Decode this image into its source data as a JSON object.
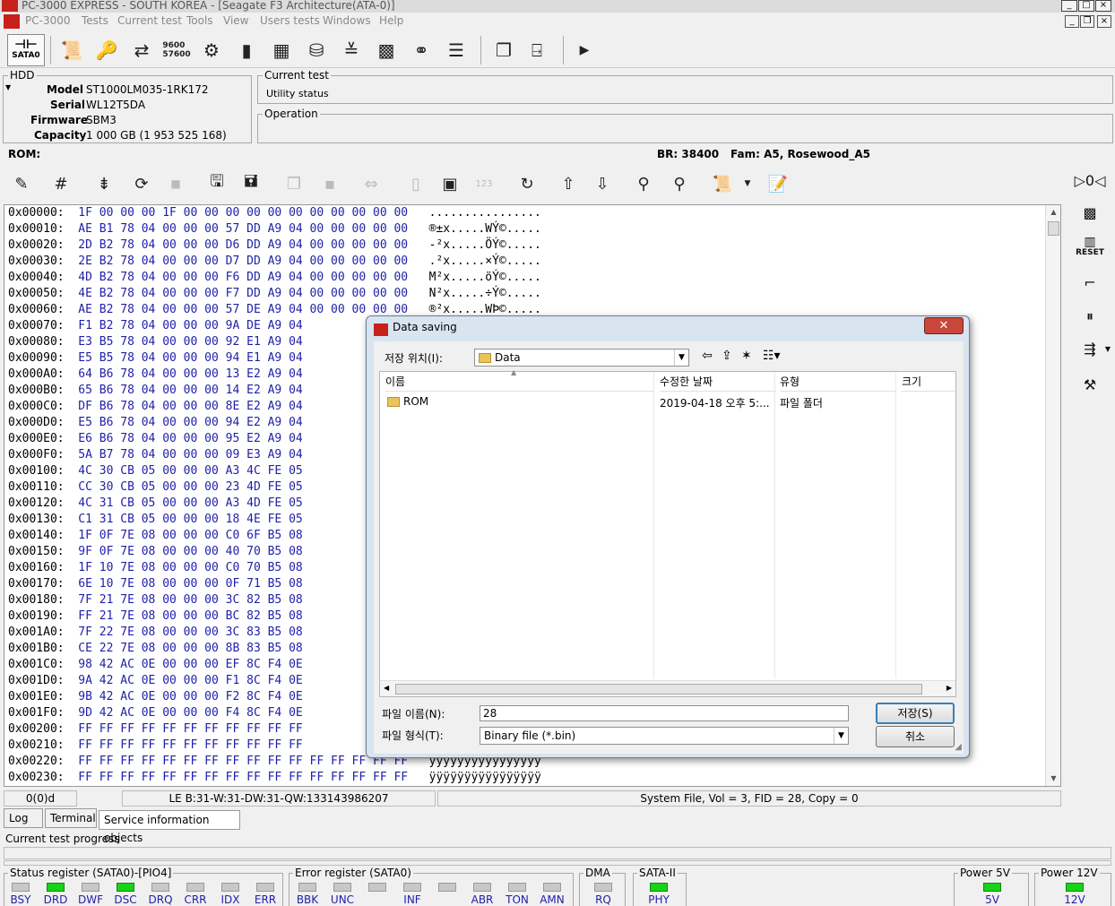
{
  "window": {
    "title": "PC-3000 EXPRESS - SOUTH KOREA - [Seagate F3 Architecture(ATA-0)]"
  },
  "menu": {
    "items": [
      "PC-3000",
      "Tests",
      "Current test",
      "Tools",
      "View",
      "Users tests",
      "Windows",
      "Help"
    ]
  },
  "toolbar": {
    "sata_label": "SATA0"
  },
  "hdd": {
    "group_label": "HDD",
    "model_key": "Model",
    "model": "ST1000LM035-1RK172",
    "serial_key": "Serial",
    "serial": "WL12T5DA",
    "firmware_key": "Firmware",
    "firmware": "SBM3",
    "capacity_key": "Capacity",
    "capacity": "1 000 GB (1 953 525 168)"
  },
  "current_test": {
    "label": "Current test",
    "value": "Utility status"
  },
  "operation": {
    "label": "Operation"
  },
  "rom_bar": {
    "rom": "ROM:",
    "br": "BR: 38400",
    "fam": "Fam: A5, Rosewood_A5"
  },
  "hex_rows": [
    {
      "addr": "0x00000:",
      "bytes": "1F 00 00 00 1F 00 00 00 00 00 00 00 00 00 00 00",
      "ascii": "................"
    },
    {
      "addr": "0x00010:",
      "bytes": "AE B1 78 04 00 00 00 57 DD A9 04 00 00 00 00 00",
      "ascii": "®±x.....WÝ©....."
    },
    {
      "addr": "0x00020:",
      "bytes": "2D B2 78 04 00 00 00 D6 DD A9 04 00 00 00 00 00",
      "ascii": "-²x.....ÖÝ©....."
    },
    {
      "addr": "0x00030:",
      "bytes": "2E B2 78 04 00 00 00 D7 DD A9 04 00 00 00 00 00",
      "ascii": ".²x.....×Ý©....."
    },
    {
      "addr": "0x00040:",
      "bytes": "4D B2 78 04 00 00 00 F6 DD A9 04 00 00 00 00 00",
      "ascii": "M²x.....öÝ©....."
    },
    {
      "addr": "0x00050:",
      "bytes": "4E B2 78 04 00 00 00 F7 DD A9 04 00 00 00 00 00",
      "ascii": "N²x.....÷Ý©....."
    },
    {
      "addr": "0x00060:",
      "bytes": "AE B2 78 04 00 00 00 57 DE A9 04 00 00 00 00 00",
      "ascii": "®²x.....WÞ©....."
    },
    {
      "addr": "0x00070:",
      "bytes": "F1 B2 78 04 00 00 00 9A DE A9 04",
      "ascii": ""
    },
    {
      "addr": "0x00080:",
      "bytes": "E3 B5 78 04 00 00 00 92 E1 A9 04",
      "ascii": ""
    },
    {
      "addr": "0x00090:",
      "bytes": "E5 B5 78 04 00 00 00 94 E1 A9 04",
      "ascii": ""
    },
    {
      "addr": "0x000A0:",
      "bytes": "64 B6 78 04 00 00 00 13 E2 A9 04",
      "ascii": ""
    },
    {
      "addr": "0x000B0:",
      "bytes": "65 B6 78 04 00 00 00 14 E2 A9 04",
      "ascii": ""
    },
    {
      "addr": "0x000C0:",
      "bytes": "DF B6 78 04 00 00 00 8E E2 A9 04",
      "ascii": ""
    },
    {
      "addr": "0x000D0:",
      "bytes": "E5 B6 78 04 00 00 00 94 E2 A9 04",
      "ascii": ""
    },
    {
      "addr": "0x000E0:",
      "bytes": "E6 B6 78 04 00 00 00 95 E2 A9 04",
      "ascii": ""
    },
    {
      "addr": "0x000F0:",
      "bytes": "5A B7 78 04 00 00 00 09 E3 A9 04",
      "ascii": ""
    },
    {
      "addr": "0x00100:",
      "bytes": "4C 30 CB 05 00 00 00 A3 4C FE 05",
      "ascii": ""
    },
    {
      "addr": "0x00110:",
      "bytes": "CC 30 CB 05 00 00 00 23 4D FE 05",
      "ascii": ""
    },
    {
      "addr": "0x00120:",
      "bytes": "4C 31 CB 05 00 00 00 A3 4D FE 05",
      "ascii": ""
    },
    {
      "addr": "0x00130:",
      "bytes": "C1 31 CB 05 00 00 00 18 4E FE 05",
      "ascii": ""
    },
    {
      "addr": "0x00140:",
      "bytes": "1F 0F 7E 08 00 00 00 C0 6F B5 08",
      "ascii": ""
    },
    {
      "addr": "0x00150:",
      "bytes": "9F 0F 7E 08 00 00 00 40 70 B5 08",
      "ascii": ""
    },
    {
      "addr": "0x00160:",
      "bytes": "1F 10 7E 08 00 00 00 C0 70 B5 08",
      "ascii": ""
    },
    {
      "addr": "0x00170:",
      "bytes": "6E 10 7E 08 00 00 00 0F 71 B5 08",
      "ascii": ""
    },
    {
      "addr": "0x00180:",
      "bytes": "7F 21 7E 08 00 00 00 3C 82 B5 08",
      "ascii": ""
    },
    {
      "addr": "0x00190:",
      "bytes": "FF 21 7E 08 00 00 00 BC 82 B5 08",
      "ascii": ""
    },
    {
      "addr": "0x001A0:",
      "bytes": "7F 22 7E 08 00 00 00 3C 83 B5 08",
      "ascii": ""
    },
    {
      "addr": "0x001B0:",
      "bytes": "CE 22 7E 08 00 00 00 8B 83 B5 08",
      "ascii": ""
    },
    {
      "addr": "0x001C0:",
      "bytes": "98 42 AC 0E 00 00 00 EF 8C F4 0E",
      "ascii": ""
    },
    {
      "addr": "0x001D0:",
      "bytes": "9A 42 AC 0E 00 00 00 F1 8C F4 0E",
      "ascii": ""
    },
    {
      "addr": "0x001E0:",
      "bytes": "9B 42 AC 0E 00 00 00 F2 8C F4 0E",
      "ascii": ""
    },
    {
      "addr": "0x001F0:",
      "bytes": "9D 42 AC 0E 00 00 00 F4 8C F4 0E",
      "ascii": ""
    },
    {
      "addr": "0x00200:",
      "bytes": "FF FF FF FF FF FF FF FF FF FF FF",
      "ascii": ""
    },
    {
      "addr": "0x00210:",
      "bytes": "FF FF FF FF FF FF FF FF FF FF FF",
      "ascii": ""
    },
    {
      "addr": "0x00220:",
      "bytes": "FF FF FF FF FF FF FF FF FF FF FF FF FF FF FF FF",
      "ascii": "ÿÿÿÿÿÿÿÿÿÿÿÿÿÿÿÿ"
    },
    {
      "addr": "0x00230:",
      "bytes": "FF FF FF FF FF FF FF FF FF FF FF FF FF FF FF FF",
      "ascii": "ÿÿÿÿÿÿÿÿÿÿÿÿÿÿÿÿ"
    }
  ],
  "status": {
    "position": "0(0)d",
    "le": "LE B:31-W:31-DW:31-QW:133143986207",
    "file_info": "System File, Vol = 3, FID = 28, Copy = 0"
  },
  "tabs": [
    "Log",
    "Terminal",
    "Service information objects"
  ],
  "progress_label": "Current test progress",
  "status_register": {
    "label": "Status register (SATA0)-[PIO4]",
    "flags": [
      {
        "name": "BSY",
        "on": false
      },
      {
        "name": "DRD",
        "on": true
      },
      {
        "name": "DWF",
        "on": false
      },
      {
        "name": "DSC",
        "on": true
      },
      {
        "name": "DRQ",
        "on": false
      },
      {
        "name": "CRR",
        "on": false
      },
      {
        "name": "IDX",
        "on": false
      },
      {
        "name": "ERR",
        "on": false
      }
    ]
  },
  "error_register": {
    "label": "Error register (SATA0)",
    "flags": [
      {
        "name": "BBK",
        "on": false
      },
      {
        "name": "UNC",
        "on": false
      },
      {
        "name": "",
        "on": false
      },
      {
        "name": "INF",
        "on": false
      },
      {
        "name": "",
        "on": false
      },
      {
        "name": "ABR",
        "on": false
      },
      {
        "name": "TON",
        "on": false
      },
      {
        "name": "AMN",
        "on": false
      }
    ]
  },
  "dma": {
    "label": "DMA",
    "flag": "RQ",
    "on": false
  },
  "sata2": {
    "label": "SATA-II",
    "flag": "PHY",
    "on": true
  },
  "power5": {
    "label": "Power 5V",
    "flag": "5V",
    "on": true
  },
  "power12": {
    "label": "Power 12V",
    "flag": "12V",
    "on": true
  },
  "right_panel": {
    "reset_label": "RESET"
  },
  "dialog": {
    "title": "Data saving",
    "save_in_label": "저장 위치(I):",
    "save_in_value": "Data",
    "columns": [
      "이름",
      "수정한 날짜",
      "유형",
      "크기"
    ],
    "files": [
      {
        "name": "ROM",
        "modified": "2019-04-18 오후 5:...",
        "type": "파일 폴더",
        "size": ""
      }
    ],
    "filename_label": "파일 이름(N):",
    "filename_value": "28",
    "filetype_label": "파일 형식(T):",
    "filetype_value": "Binary file (*.bin)",
    "save_button": "저장(S)",
    "cancel_button": "취소"
  },
  "colors": {
    "accent_red": "#c8201b",
    "led_on": "#18d318",
    "hex_blue": "#1f1fa8"
  }
}
